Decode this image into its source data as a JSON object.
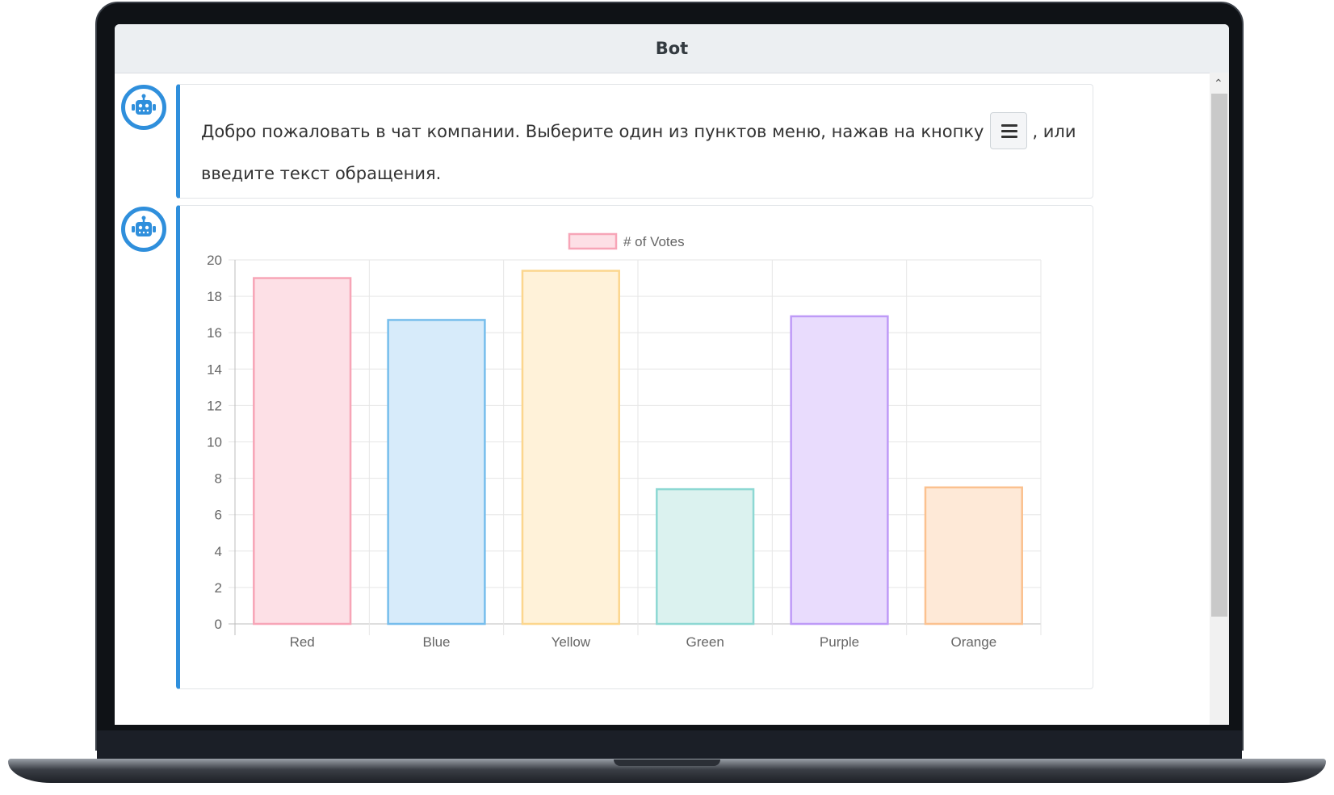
{
  "window": {
    "title": "Bot"
  },
  "messages": [
    {
      "text_before": "Добро пожаловать в чат компании. Выберите один из пунктов меню, нажав на кнопку",
      "text_after": ", или введите текст обращения.",
      "inline_button_icon": "hamburger-menu-icon"
    }
  ],
  "avatar_icon": "robot-icon",
  "colors": {
    "accent": "#2f8fdc"
  },
  "chart_data": {
    "type": "bar",
    "title": "",
    "xlabel": "",
    "ylabel": "",
    "legend": {
      "label": "# of Votes",
      "position": "top"
    },
    "categories": [
      "Red",
      "Blue",
      "Yellow",
      "Green",
      "Purple",
      "Orange"
    ],
    "series": [
      {
        "name": "# of Votes",
        "values": [
          19,
          16.7,
          19.4,
          7.4,
          16.9,
          7.5
        ]
      }
    ],
    "ylim": [
      0,
      20
    ],
    "yticks": [
      0,
      2,
      4,
      6,
      8,
      10,
      12,
      14,
      16,
      18,
      20
    ],
    "grid": true,
    "bar_fills": [
      "#fde0e6",
      "#d7ebfa",
      "#fff2d9",
      "#dbf2ef",
      "#e9dcfd",
      "#fee9d7"
    ],
    "bar_strokes": [
      "#f7a5b7",
      "#76bdec",
      "#fcd68d",
      "#8dd8d3",
      "#be9af7",
      "#fbc18f"
    ]
  }
}
